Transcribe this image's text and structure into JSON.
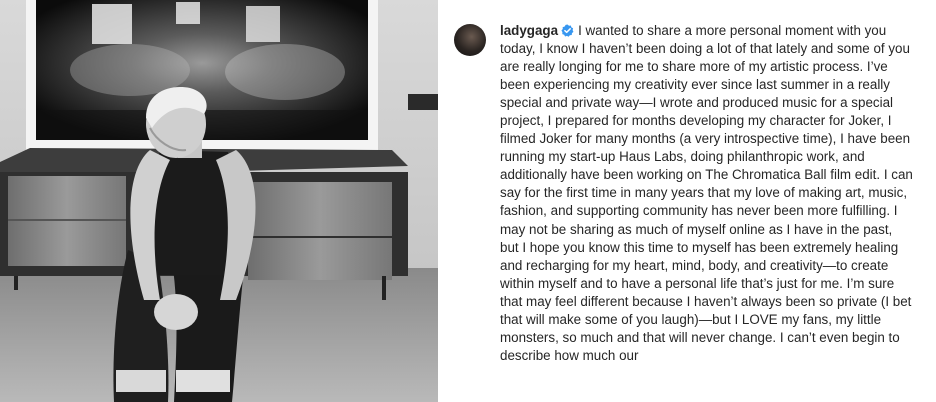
{
  "post": {
    "username": "ladygaga",
    "verified_icon": "verified-badge-icon",
    "caption": "I wanted to share a more personal moment with you today, I know I haven’t been doing a lot of that lately and some of you are really longing for me to share more of my artistic process. I’ve been experiencing my creativity ever since last summer in a really special and private way—I wrote and produced music for a special project, I prepared for months developing my character for Joker, I filmed Joker for many months (a very introspective time), I have been running my start-up Haus Labs, doing philanthropic work, and additionally have been working on The Chromatica Ball film edit. I can say for the first time in many years that my love of making art, music, fashion, and supporting community has never been more fulfilling. I may not be sharing as much of myself online as I have in the past, but I hope you know this time to myself has been extremely healing and recharging for my heart, mind, body, and creativity—to create within myself and to have a personal life that’s just for me. I’m sure that may feel different because I haven’t always been so private (I bet that will make some of you laugh)—but I LOVE my fans, my little monsters, so much and that will never change. I can’t even begin to describe how much our"
  },
  "colors": {
    "verified": "#3897f0",
    "text": "#262626"
  }
}
